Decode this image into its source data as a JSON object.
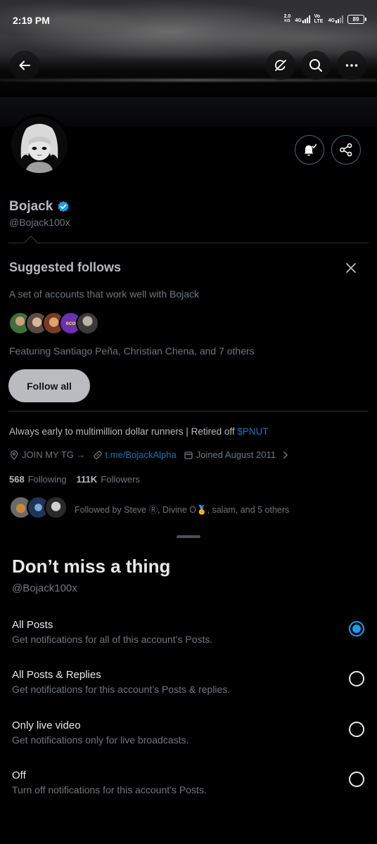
{
  "status_bar": {
    "time": "2:19 PM",
    "net_speed_value": "2.0",
    "net_speed_unit": "K/S",
    "net_type_1": "4G",
    "net_type_2": "4G",
    "volte": "Vo LTE",
    "battery": "89"
  },
  "header": {
    "back_icon": "back-arrow-icon",
    "grok_icon": "grok-icon",
    "search_icon": "search-icon",
    "more_icon": "more-icon"
  },
  "profile": {
    "display_name": "Bojack",
    "handle": "@Bojack100x",
    "verified": true,
    "bell_icon": "notification-bell-icon",
    "share_icon": "share-icon"
  },
  "suggested": {
    "title": "Suggested follows",
    "subtitle": "A set of accounts that work well with Bojack",
    "featuring": "Featuring Santiago Peña, Christian Chena, and 7 others",
    "follow_all": "Follow all",
    "avatar_label": "eco"
  },
  "bio": {
    "text": "Always early to multimillion dollar runners | Retired off ",
    "cashtag": "$PNUT",
    "location": "JOIN MY TG →",
    "link": "t.me/BojackAlpha",
    "joined": "Joined August 2011",
    "following_count": "568",
    "following_label": "Following",
    "followers_count": "111K",
    "followers_label": "Followers",
    "followed_by": "Followed by Steve Ⓡ, Divine Ö🏅, salam, and 5 others"
  },
  "sheet": {
    "title": "Don’t miss a thing",
    "handle": "@Bojack100x",
    "options": [
      {
        "title": "All Posts",
        "desc": "Get notifications for all of this account’s Posts.",
        "selected": true
      },
      {
        "title": "All Posts & Replies",
        "desc": "Get notifications for this account’s Posts & replies.",
        "selected": false
      },
      {
        "title": "Only live video",
        "desc": "Get notifications only for live broadcasts.",
        "selected": false
      },
      {
        "title": "Off",
        "desc": "Turn off notifications for this account’s Posts.",
        "selected": false
      }
    ]
  },
  "colors": {
    "accent": "#1d9bf0",
    "link": "#1d75b5",
    "background": "#000000"
  }
}
